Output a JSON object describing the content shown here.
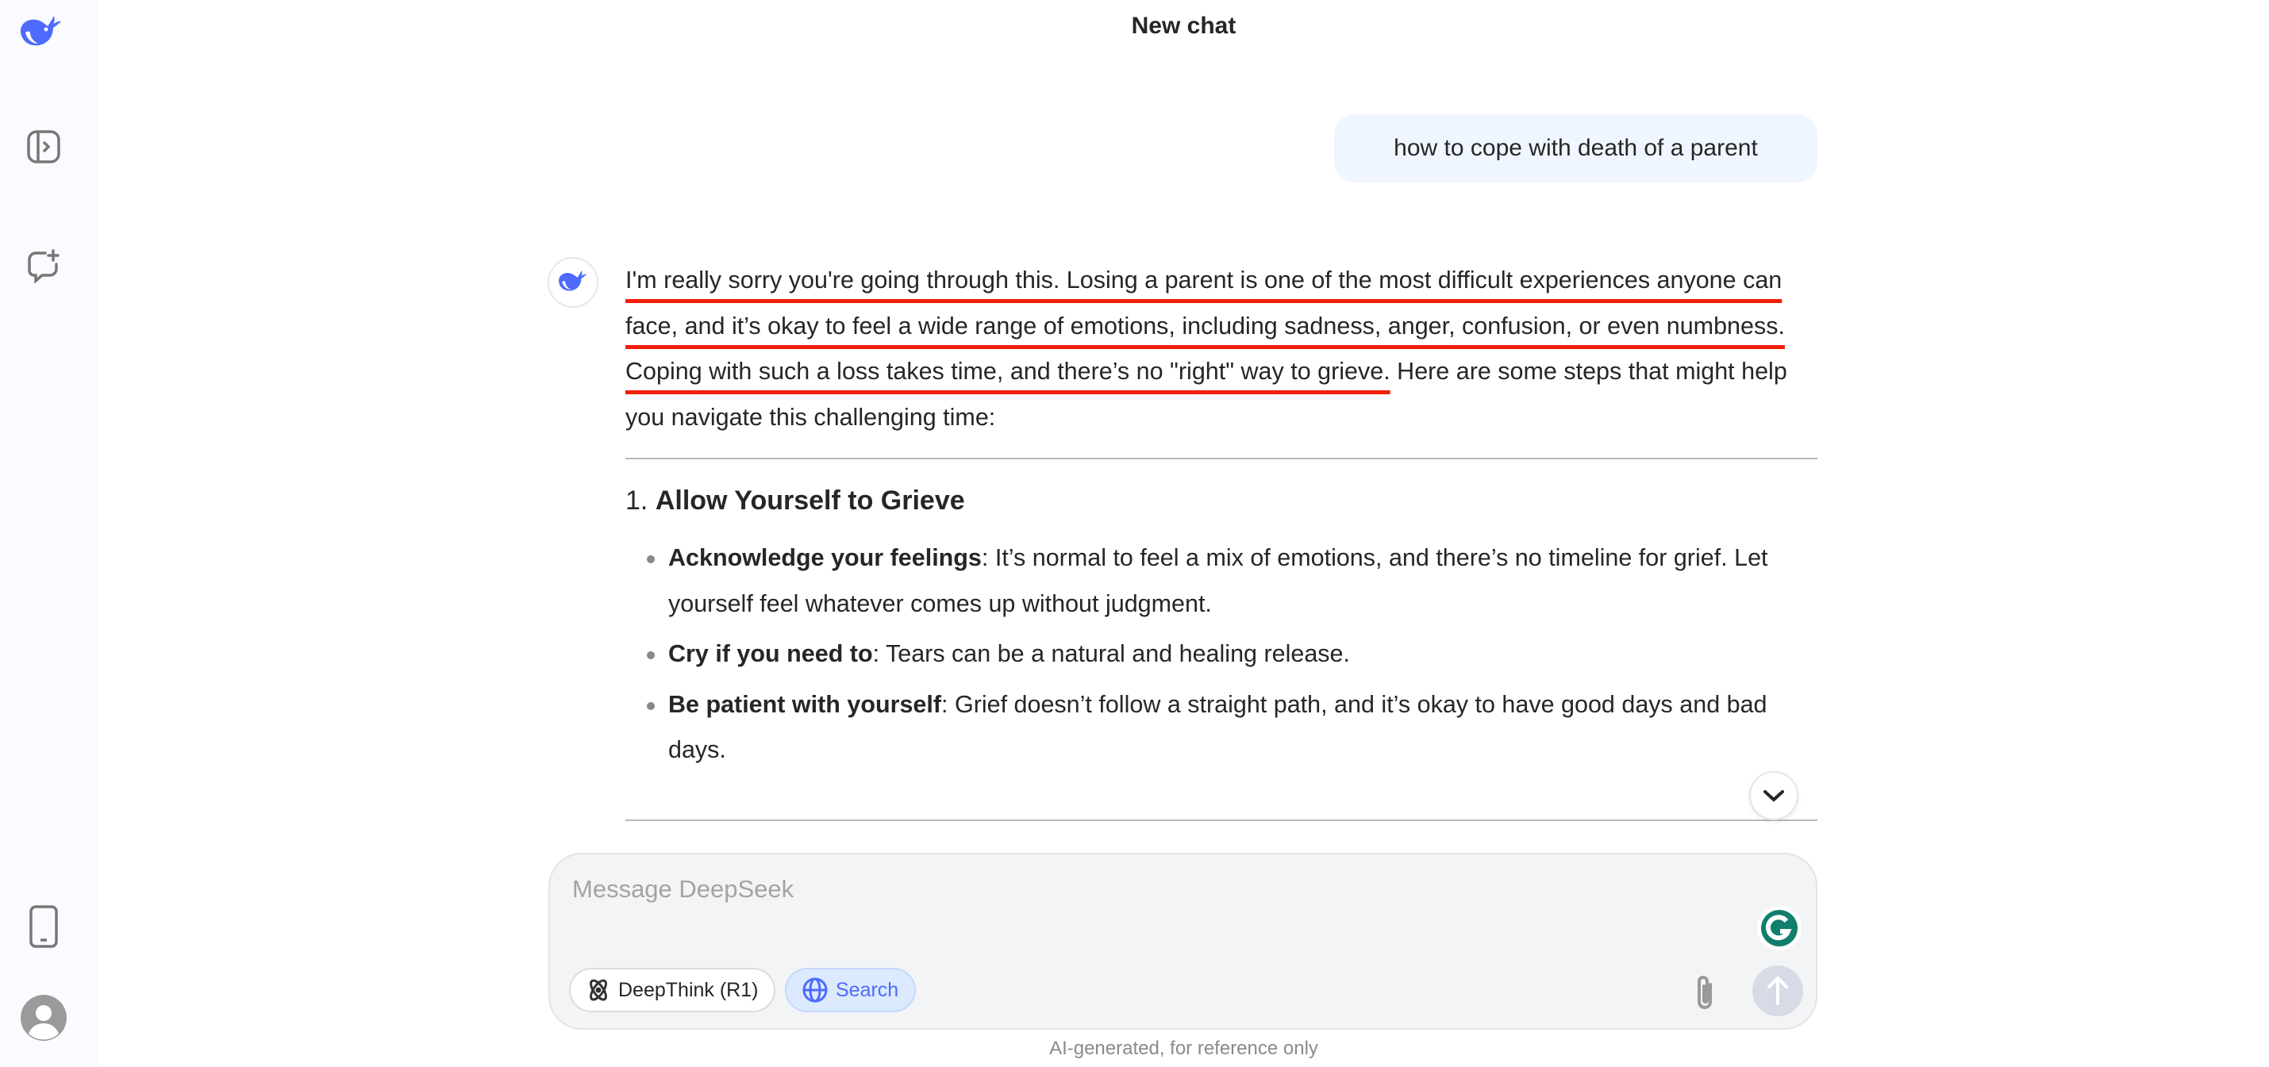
{
  "header": {
    "title": "New chat"
  },
  "sidebar": {
    "icons": [
      "deepseek-logo",
      "toggle-sidebar-icon",
      "new-chat-icon",
      "mobile-app-icon",
      "user-avatar-icon"
    ]
  },
  "conversation": {
    "user_message": "how to cope with death of a parent",
    "answer": {
      "intro_underlined": "I'm really sorry you're going through this. Losing a parent is one of the most difficult experiences anyone can face, and it’s okay to feel a wide range of emotions, including sadness, anger, confusion, or even numbness. Coping with such a loss takes time, and there’s no \"right\" way to grieve.",
      "intro_rest": " Here are some steps that might help you navigate this challenging time:",
      "section_number": "1. ",
      "section_title": "Allow Yourself to Grieve",
      "bullets": [
        {
          "bold": "Acknowledge your feelings",
          "text": ": It’s normal to feel a mix of emotions, and there’s no timeline for grief. Let yourself feel whatever comes up without judgment."
        },
        {
          "bold": "Cry if you need to",
          "text": ": Tears can be a natural and healing release."
        },
        {
          "bold": "Be patient with yourself",
          "text": ": Grief doesn’t follow a straight path, and it’s okay to have good days and bad days."
        }
      ]
    }
  },
  "composer": {
    "placeholder": "Message DeepSeek",
    "deepthink_label": "DeepThink (R1)",
    "search_label": "Search"
  },
  "footer": {
    "disclaimer": "AI-generated, for reference only"
  },
  "colors": {
    "accent": "#4d6bfe",
    "underline": "#f01e0a",
    "grammarly": "#0f7f6b"
  }
}
